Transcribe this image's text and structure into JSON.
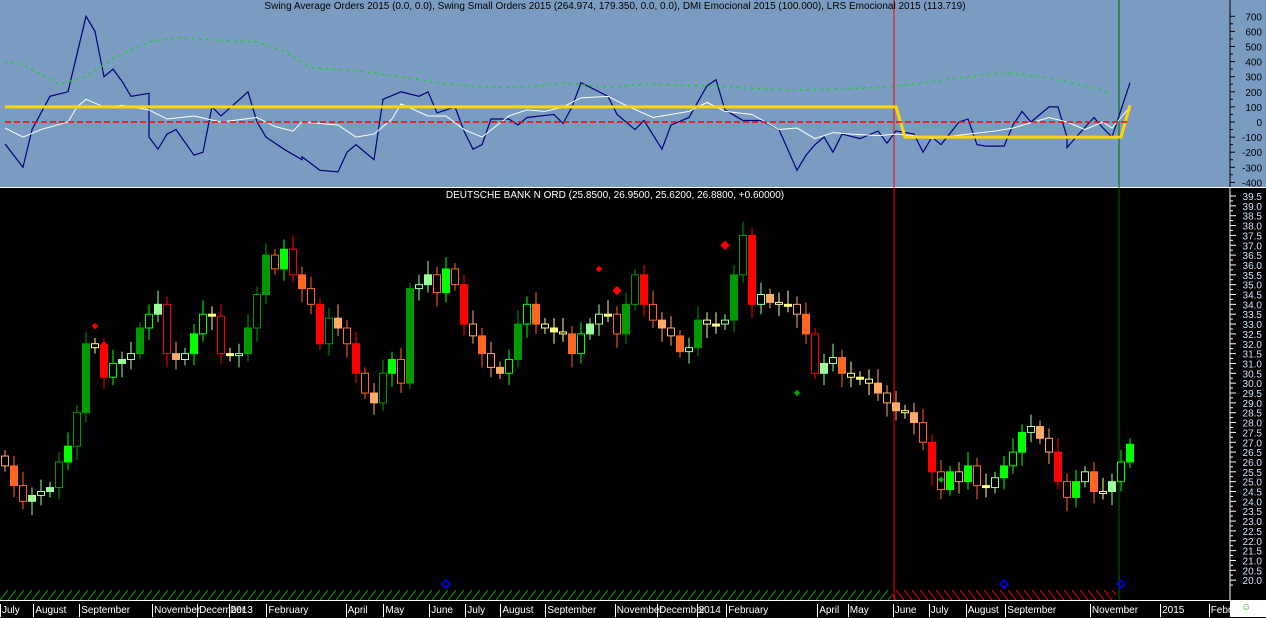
{
  "indicator_title": "Swing Average Orders 2015 (0.0, 0.0), Swing Small Orders 2015 (264.974, 179.350, 0.0, 0.0), DMI Emocional 2015 (100.000), LRS Emocional 2015 (113.719)",
  "price_title": "DEUTSCHE BANK N ORD (25.8500, 26.9500, 25.6200, 26.8800, +0.60000)",
  "colors": {
    "indicator_bg": "#7b9cc1",
    "price_bg": "#000000",
    "swing": "#000080",
    "average": "#ffffff",
    "dmi": "#00dd00",
    "lrs": "#ffd700",
    "zero": "#ff0000"
  },
  "chart_data": [
    {
      "type": "line",
      "title": "Swing Average Orders 2015 / Swing Small Orders 2015 / DMI Emocional 2015 / LRS Emocional 2015",
      "ylim": [
        -420,
        780
      ],
      "yticks": [
        "700",
        "600",
        "500",
        "400",
        "300",
        "200",
        "100",
        "0",
        "-100",
        "-200",
        "-300",
        "-400"
      ],
      "x_unit": "week",
      "series": [
        {
          "name": "Swing Small Orders",
          "points": [
            [
              0,
              -145
            ],
            [
              2,
              -300
            ],
            [
              3,
              -50
            ],
            [
              5,
              170
            ],
            [
              7,
              200
            ],
            [
              8,
              450
            ],
            [
              9,
              700
            ],
            [
              10,
              600
            ],
            [
              11,
              300
            ],
            [
              12,
              350
            ],
            [
              13,
              270
            ],
            [
              14,
              170
            ],
            [
              16,
              190
            ],
            [
              16,
              -100
            ],
            [
              17,
              -180
            ],
            [
              18,
              -80
            ],
            [
              19,
              -50
            ],
            [
              21,
              -220
            ],
            [
              22,
              -200
            ],
            [
              23,
              100
            ],
            [
              24,
              40
            ],
            [
              27,
              200
            ],
            [
              28,
              0
            ],
            [
              29,
              -100
            ],
            [
              31,
              -180
            ],
            [
              33,
              -250
            ],
            [
              33,
              -230
            ],
            [
              35,
              -320
            ],
            [
              37,
              -330
            ],
            [
              38,
              -200
            ],
            [
              39,
              -150
            ],
            [
              41,
              -250
            ],
            [
              42,
              150
            ],
            [
              44,
              200
            ],
            [
              46,
              170
            ],
            [
              47,
              200
            ],
            [
              48,
              60
            ],
            [
              50,
              100
            ],
            [
              51,
              -60
            ],
            [
              52,
              -180
            ],
            [
              53,
              -150
            ],
            [
              54,
              20
            ],
            [
              56,
              20
            ],
            [
              57,
              -20
            ],
            [
              58,
              30
            ],
            [
              61,
              50
            ],
            [
              62,
              -10
            ],
            [
              63,
              100
            ],
            [
              64,
              260
            ],
            [
              67,
              170
            ],
            [
              68,
              50
            ],
            [
              70,
              -50
            ],
            [
              71,
              10
            ],
            [
              73,
              -180
            ],
            [
              74,
              -20
            ],
            [
              76,
              30
            ],
            [
              78,
              240
            ],
            [
              79,
              280
            ],
            [
              80,
              80
            ],
            [
              82,
              10
            ],
            [
              84,
              10
            ],
            [
              86,
              -50
            ],
            [
              88,
              -320
            ],
            [
              89,
              -220
            ],
            [
              90,
              -150
            ],
            [
              91,
              -100
            ],
            [
              92,
              -200
            ],
            [
              93,
              -80
            ],
            [
              95,
              -110
            ],
            [
              97,
              -60
            ],
            [
              98,
              -140
            ],
            [
              99,
              -60
            ],
            [
              101,
              -80
            ],
            [
              102,
              -200
            ],
            [
              103,
              -100
            ],
            [
              104,
              -150
            ],
            [
              106,
              0
            ],
            [
              107,
              20
            ],
            [
              108,
              -150
            ],
            [
              109,
              -160
            ],
            [
              111,
              -160
            ],
            [
              112,
              -20
            ],
            [
              113,
              70
            ],
            [
              114,
              0
            ],
            [
              116,
              100
            ],
            [
              117,
              100
            ],
            [
              118,
              -100
            ],
            [
              118,
              -170
            ],
            [
              119,
              -100
            ],
            [
              121,
              30
            ],
            [
              122,
              -40
            ],
            [
              123,
              -100
            ],
            [
              125,
              260
            ]
          ]
        },
        {
          "name": "Swing Average Orders",
          "points": [
            [
              0,
              -40
            ],
            [
              2,
              -100
            ],
            [
              4,
              -50
            ],
            [
              7,
              0
            ],
            [
              8,
              100
            ],
            [
              9,
              150
            ],
            [
              11,
              100
            ],
            [
              13,
              110
            ],
            [
              16,
              80
            ],
            [
              18,
              20
            ],
            [
              21,
              40
            ],
            [
              24,
              0
            ],
            [
              28,
              30
            ],
            [
              30,
              -30
            ],
            [
              32,
              -60
            ],
            [
              33,
              0
            ],
            [
              37,
              -20
            ],
            [
              39,
              -100
            ],
            [
              41,
              -80
            ],
            [
              43,
              20
            ],
            [
              44,
              120
            ],
            [
              47,
              40
            ],
            [
              49,
              40
            ],
            [
              51,
              -50
            ],
            [
              53,
              -100
            ],
            [
              56,
              40
            ],
            [
              58,
              80
            ],
            [
              60,
              70
            ],
            [
              62,
              100
            ],
            [
              64,
              160
            ],
            [
              67,
              170
            ],
            [
              69,
              110
            ],
            [
              72,
              30
            ],
            [
              76,
              70
            ],
            [
              78,
              130
            ],
            [
              80,
              70
            ],
            [
              83,
              50
            ],
            [
              86,
              -50
            ],
            [
              88,
              -40
            ],
            [
              90,
              -110
            ],
            [
              92,
              -70
            ],
            [
              94,
              -80
            ],
            [
              97,
              -90
            ],
            [
              99,
              -80
            ],
            [
              101,
              -90
            ],
            [
              103,
              -110
            ],
            [
              107,
              -80
            ],
            [
              110,
              -60
            ],
            [
              112,
              -40
            ],
            [
              116,
              30
            ],
            [
              118,
              0
            ],
            [
              120,
              -50
            ],
            [
              122,
              0
            ],
            [
              123,
              -40
            ],
            [
              125,
              100
            ]
          ]
        },
        {
          "name": "DMI Emocional",
          "style": "dotted",
          "points": [
            [
              0,
              400
            ],
            [
              2,
              380
            ],
            [
              6,
              250
            ],
            [
              9,
              300
            ],
            [
              12,
              420
            ],
            [
              16,
              530
            ],
            [
              19,
              560
            ],
            [
              24,
              540
            ],
            [
              28,
              530
            ],
            [
              31,
              470
            ],
            [
              34,
              360
            ],
            [
              39,
              340
            ],
            [
              44,
              300
            ],
            [
              48,
              260
            ],
            [
              53,
              230
            ],
            [
              58,
              230
            ],
            [
              62,
              260
            ],
            [
              67,
              230
            ],
            [
              71,
              250
            ],
            [
              78,
              240
            ],
            [
              87,
              210
            ],
            [
              98,
              230
            ],
            [
              102,
              260
            ],
            [
              107,
              300
            ],
            [
              111,
              330
            ],
            [
              116,
              290
            ],
            [
              120,
              240
            ],
            [
              123,
              190
            ]
          ]
        },
        {
          "name": "LRS Emocional",
          "points": [
            [
              0,
              100
            ],
            [
              99,
              100
            ],
            [
              100,
              -100
            ],
            [
              124,
              -100
            ],
            [
              125,
              110
            ]
          ]
        },
        {
          "name": "Zero line",
          "style": "dotted",
          "points": [
            [
              0,
              0
            ],
            [
              125,
              0
            ]
          ]
        }
      ]
    },
    {
      "type": "candlestick",
      "title": "DEUTSCHE BANK N ORD",
      "ylim": [
        19.6,
        39.8
      ],
      "yticks": [
        "39.5",
        "39.0",
        "38.5",
        "38.0",
        "37.5",
        "37.0",
        "36.5",
        "36.0",
        "35.5",
        "35.0",
        "34.5",
        "34.0",
        "33.5",
        "33.0",
        "32.5",
        "32.0",
        "31.5",
        "31.0",
        "30.5",
        "30.0",
        "29.5",
        "29.0",
        "28.5",
        "28.0",
        "27.5",
        "27.0",
        "26.5",
        "26.0",
        "25.5",
        "25.0",
        "24.5",
        "24.0",
        "23.5",
        "23.0",
        "22.5",
        "22.0",
        "21.5",
        "21.0",
        "20.5",
        "20.0"
      ],
      "first_open": 26.3,
      "closes": [
        25.8,
        24.8,
        24.0,
        24.3,
        24.5,
        24.7,
        26.0,
        26.8,
        28.5,
        32.0,
        31.8,
        30.3,
        31.0,
        31.2,
        31.5,
        32.8,
        33.5,
        34.0,
        31.5,
        31.2,
        31.5,
        32.5,
        33.5,
        33.4,
        31.5,
        31.4,
        31.5,
        32.8,
        34.5,
        36.5,
        35.8,
        36.8,
        35.5,
        34.8,
        34.0,
        32.0,
        33.3,
        32.8,
        32.0,
        30.5,
        29.5,
        29.0,
        30.5,
        31.2,
        30.0,
        34.8,
        35.0,
        35.5,
        34.6,
        35.8,
        35.0,
        33.0,
        32.4,
        31.5,
        30.8,
        30.5,
        31.2,
        33.0,
        34.0,
        33.0,
        32.8,
        32.6,
        32.5,
        31.5,
        32.5,
        33.0,
        33.5,
        33.5,
        32.5,
        34.0,
        35.5,
        34.0,
        33.2,
        32.8,
        32.4,
        31.6,
        31.8,
        33.2,
        33.0,
        33.0,
        33.2,
        35.5,
        37.5,
        34.0,
        34.5,
        34.1,
        34.0,
        34.0,
        33.5,
        32.5,
        30.5,
        31.0,
        31.3,
        30.5,
        30.3,
        30.2,
        30.0,
        29.5,
        29.0,
        28.6,
        28.5,
        28.0,
        27.0,
        25.5,
        24.6,
        25.5,
        25.0,
        25.8,
        24.8,
        24.7,
        25.2,
        25.8,
        26.5,
        27.5,
        27.8,
        27.2,
        26.5,
        25.0,
        24.2,
        25.0,
        25.5,
        24.5,
        24.5,
        25.0,
        26.0,
        26.9
      ],
      "markers": [
        {
          "week": 10,
          "price": 32.9,
          "color": "#ff0000",
          "size": "small"
        },
        {
          "week": 11,
          "price": 31.9,
          "color": "#ff0000",
          "size": "large"
        },
        {
          "week": 66,
          "price": 35.8,
          "color": "#ff0000",
          "size": "small"
        },
        {
          "week": 68,
          "price": 34.7,
          "color": "#ff0000",
          "size": "large"
        },
        {
          "week": 80,
          "price": 37.0,
          "color": "#ff0000",
          "size": "large"
        },
        {
          "week": 88,
          "price": 29.5,
          "color": "#00aa00",
          "size": "small"
        },
        {
          "week": 104,
          "price": 25.1,
          "color": "#00aa00",
          "size": "small"
        },
        {
          "week": 49,
          "price": 19.8,
          "color": "#0000ff",
          "size": "outline"
        },
        {
          "week": 111,
          "price": 19.8,
          "color": "#0000ff",
          "size": "outline"
        },
        {
          "week": 124,
          "price": 19.8,
          "color": "#0000ff",
          "size": "outline"
        }
      ],
      "regions": [
        {
          "from_week": 0,
          "to_week": 99,
          "color": "#00aa00"
        },
        {
          "from_week": 99,
          "to_week": 124,
          "color": "#ff0000"
        }
      ],
      "vlines": [
        {
          "week": 99,
          "color": "#ff0000"
        },
        {
          "week": 124,
          "color": "#006600"
        }
      ]
    }
  ],
  "time_axis": [
    {
      "label": "July",
      "week": 0
    },
    {
      "label": "August",
      "week": 3.7
    },
    {
      "label": "September",
      "week": 8.8
    },
    {
      "label": "November",
      "week": 16.9
    },
    {
      "label": "December",
      "week": 21.9
    },
    {
      "label": "2013",
      "week": 25.4
    },
    {
      "label": "February",
      "week": 29.6
    },
    {
      "label": "April",
      "week": 38.4
    },
    {
      "label": "May",
      "week": 42.6
    },
    {
      "label": "June",
      "week": 47.7
    },
    {
      "label": "July",
      "week": 51.7
    },
    {
      "label": "August",
      "week": 55.6
    },
    {
      "label": "September",
      "week": 60.6
    },
    {
      "label": "November",
      "week": 68.3
    },
    {
      "label": "December",
      "week": 73.0
    },
    {
      "label": "2014",
      "week": 77.4
    },
    {
      "label": "February",
      "week": 80.7
    },
    {
      "label": "April",
      "week": 90.8
    },
    {
      "label": "May",
      "week": 94.2
    },
    {
      "label": "June",
      "week": 99.2
    },
    {
      "label": "July",
      "week": 103.2
    },
    {
      "label": "August",
      "week": 107.3
    },
    {
      "label": "September",
      "week": 111.7
    },
    {
      "label": "November",
      "week": 121.1
    },
    {
      "label": "2015",
      "week": 128.9
    },
    {
      "label": "Febru",
      "week": 134.3
    }
  ]
}
